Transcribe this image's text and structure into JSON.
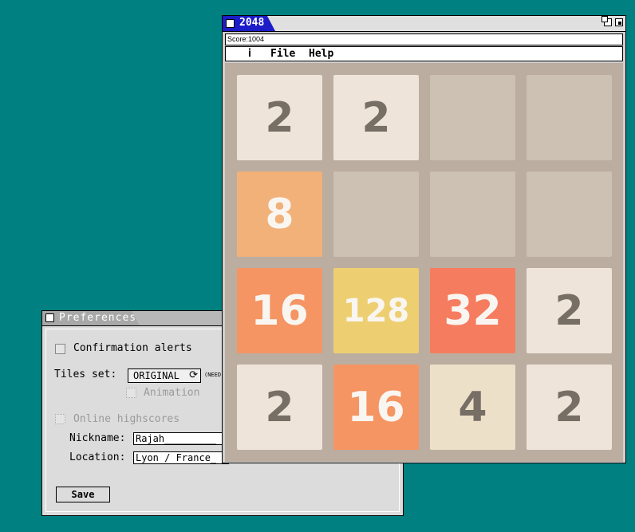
{
  "preferences": {
    "title": "Preferences",
    "confirmation_label": "Confirmation alerts",
    "tiles_set_label": "Tiles set:",
    "tiles_set_value": "ORIGINAL",
    "tiles_set_icon": "refresh-icon",
    "need_note": "(NEED",
    "animation_label": "Animation",
    "online_label": "Online highscores",
    "nickname_label": "Nickname:",
    "nickname_value": "Rajah_________",
    "location_label": "Location:",
    "location_value": "Lyon / France_",
    "save_label": "Save"
  },
  "game": {
    "title": "2048",
    "score_text": "Score:1004",
    "menu": {
      "file": "File",
      "help": "Help",
      "apple_icon": "ᾋ"
    },
    "board": [
      [
        "2",
        "2",
        "",
        ""
      ],
      [
        "8",
        "",
        "",
        ""
      ],
      [
        "16",
        "128",
        "32",
        "2"
      ],
      [
        "2",
        "16",
        "4",
        "2"
      ]
    ],
    "colors": {
      "board_bg": "#bbada0",
      "empty": "#cdc1b4",
      "2": "#eee4da",
      "4": "#ede0c8",
      "8": "#f2b179",
      "16": "#f59563",
      "32": "#f67c5f",
      "128": "#edcf72",
      "dark_text": "#776e65",
      "light_text": "#f9f6f2"
    }
  }
}
